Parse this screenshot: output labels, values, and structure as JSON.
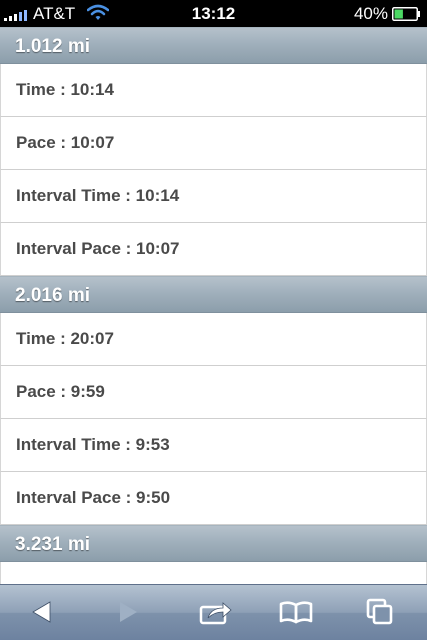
{
  "status_bar": {
    "carrier": "AT&T",
    "time": "13:12",
    "battery_percent": "40%",
    "battery_level": 0.4,
    "signal_bars": 5,
    "signal_icon": "signal-bars-icon",
    "wifi_icon": "wifi-icon",
    "battery_icon": "battery-icon"
  },
  "sections": [
    {
      "header": "1.012 mi",
      "rows": [
        {
          "label": "Time : 10:14"
        },
        {
          "label": "Pace : 10:07"
        },
        {
          "label": "Interval Time : 10:14"
        },
        {
          "label": "Interval Pace : 10:07"
        }
      ]
    },
    {
      "header": "2.016 mi",
      "rows": [
        {
          "label": "Time : 20:07"
        },
        {
          "label": "Pace : 9:59"
        },
        {
          "label": "Interval Time : 9:53"
        },
        {
          "label": "Interval Pace : 9:50"
        }
      ]
    },
    {
      "header": "3.231 mi",
      "rows": []
    }
  ],
  "toolbar": {
    "back_icon": "back-arrow-icon",
    "forward_icon": "forward-arrow-icon",
    "share_icon": "share-icon",
    "bookmarks_icon": "bookmarks-book-icon",
    "pages_icon": "pages-icon",
    "forward_enabled": false
  },
  "colors": {
    "header_gradient_top": "#b5c1cb",
    "header_gradient_bottom": "#8c9eab",
    "row_text": "#4a4a4a",
    "battery_fill": "#4cd964",
    "toolbar_top": "#b4c2d1",
    "toolbar_bottom": "#6d82a0"
  }
}
